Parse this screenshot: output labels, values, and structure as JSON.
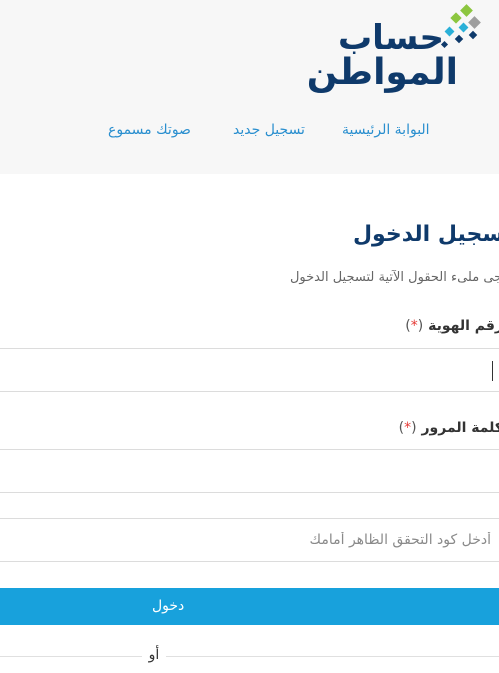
{
  "logo": {
    "line1": "حساب",
    "line2": "المواطن",
    "mark_colors": [
      "#8cc63f",
      "#9e9e9e",
      "#2ab0d8",
      "#0f3a6b"
    ]
  },
  "nav": {
    "items": [
      {
        "label": "البوابة الرئيسية"
      },
      {
        "label": "تسجيل جديد"
      },
      {
        "label": "صوتك مسموع"
      }
    ],
    "color": "#2a8fcf"
  },
  "form": {
    "title": "تسجيل الدخول",
    "subtitle": "يرجى ملىء الحقول الآتية لتسجيل الدخول",
    "id_label": "رقم الهوية",
    "password_label": "كلمة المرور",
    "required_open": "(",
    "required_star": "*",
    "required_close": ")",
    "id_value": "",
    "password_value": "",
    "captcha_placeholder": "أدخل كود التحقق الظاهر أمامك",
    "login_label": "دخول",
    "or_label": "أو"
  },
  "colors": {
    "title": "#0f3a6b",
    "button": "#18a1dc",
    "required": "#e53935"
  }
}
